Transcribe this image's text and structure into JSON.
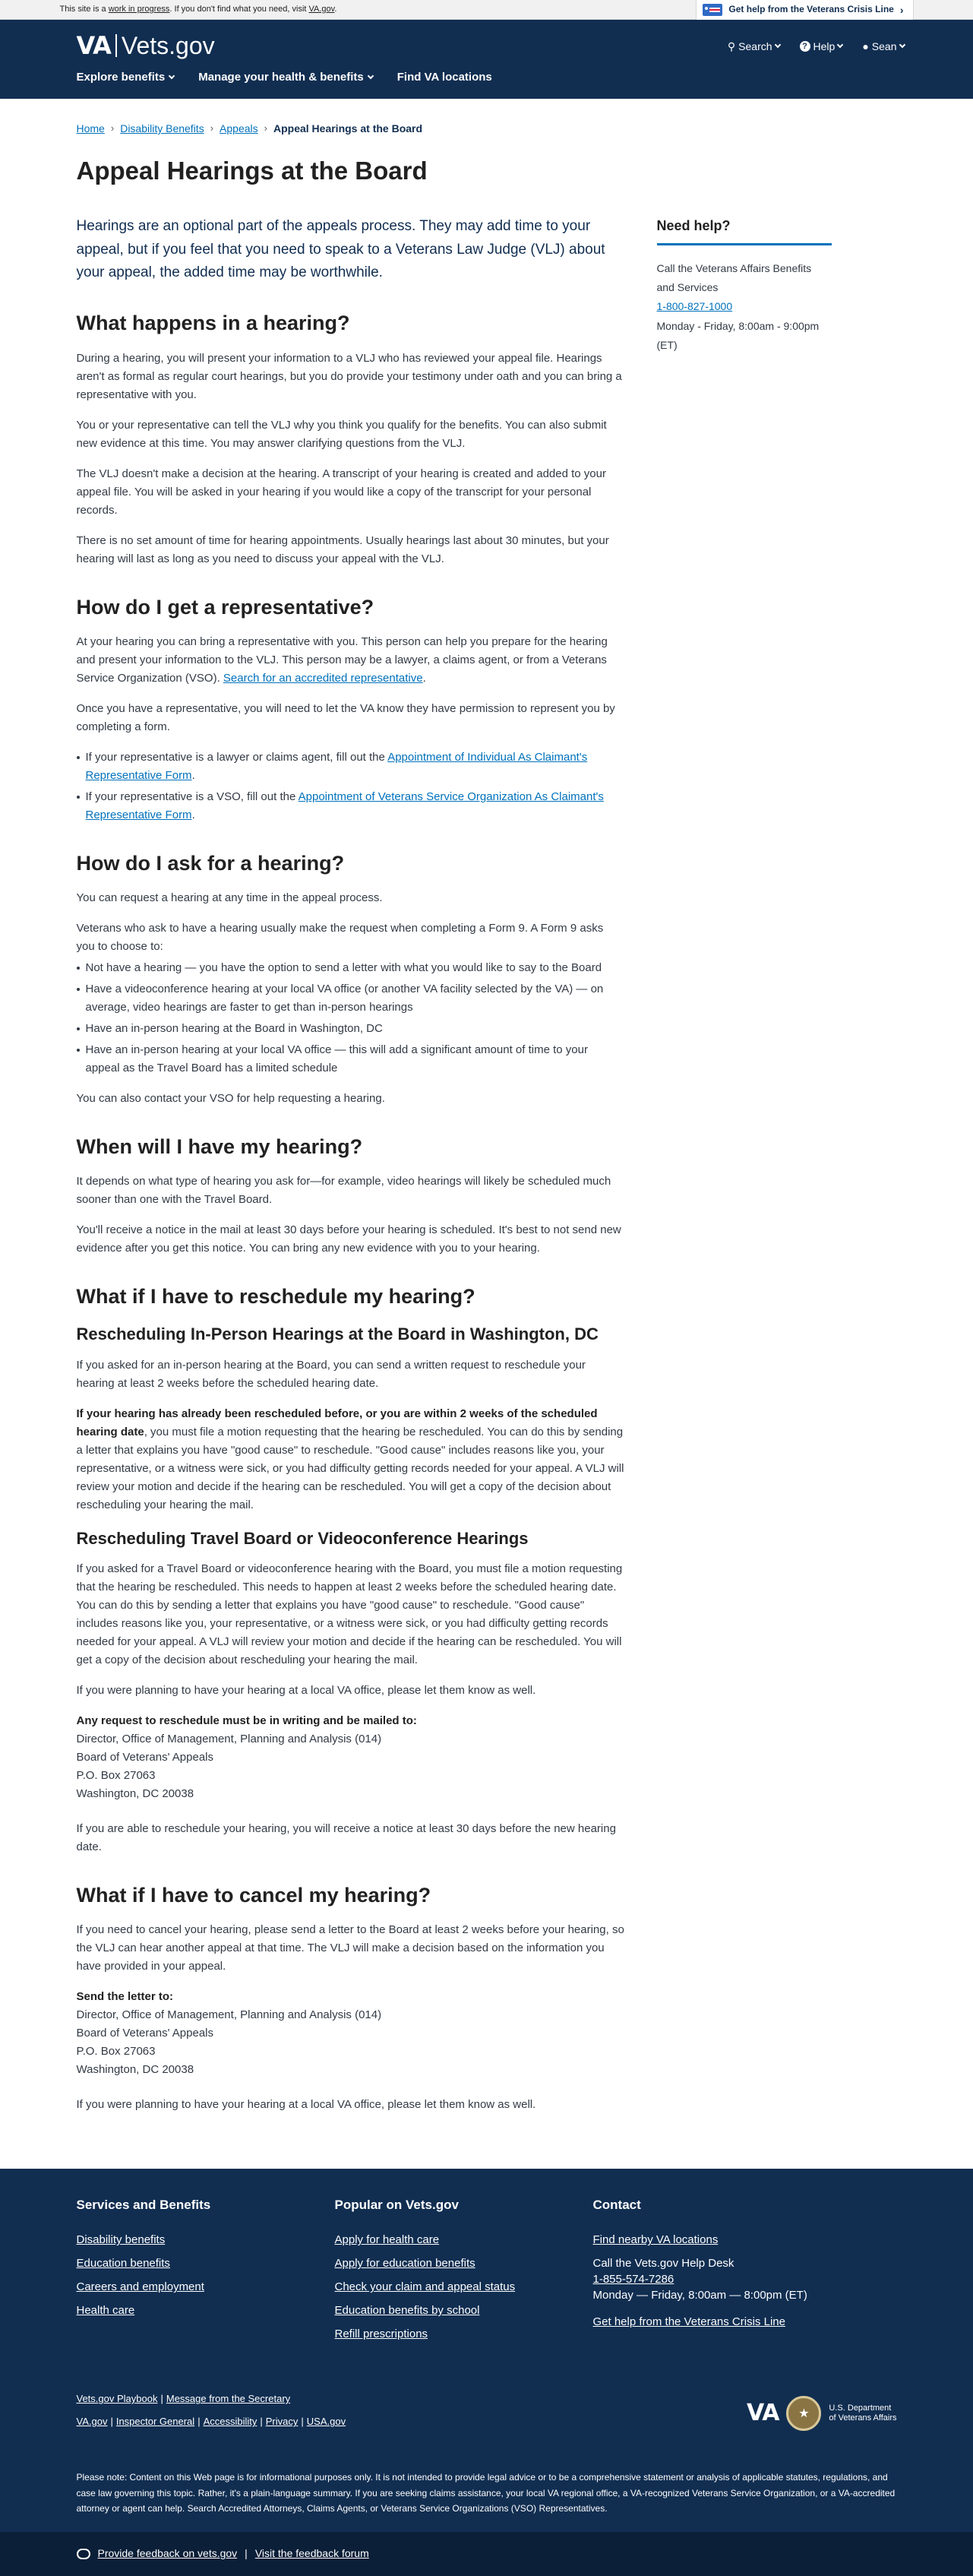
{
  "banner": {
    "msg_prefix": "This site is a",
    "msg_link": "work in progress",
    "msg_middle": ". If you don't find what you need, visit",
    "msg_link2": "VA.gov",
    "msg_suffix": ".",
    "crisis_line": "Get help from the Veterans Crisis Line"
  },
  "header": {
    "logo_va": "VA",
    "logo_site": "Vets.gov",
    "search": "Search",
    "help": "Help",
    "user": "Sean",
    "nav": [
      "Explore benefits",
      "Manage your health & benefits",
      "Find VA locations"
    ]
  },
  "breadcrumb": [
    "Home",
    "Disability Benefits",
    "Appeals",
    "Appeal Hearings at the Board"
  ],
  "page_title": "Appeal Hearings at the Board",
  "lead": "Hearings are an optional part of the appeals process. They may add time to your appeal, but if you feel that you need to speak to a Veterans Law Judge (VLJ) about your appeal, the added time may be worthwhile.",
  "s1": {
    "heading": "What happens in a hearing?",
    "p1": "During a hearing, you will present your information to a VLJ who has reviewed your appeal file. Hearings aren't as formal as regular court hearings, but you do provide your testimony under oath and you can bring a representative with you.",
    "p2": "You or your representative can tell the VLJ why you think you qualify for the benefits. You can also submit new evidence at this time. You may answer clarifying questions from the VLJ.",
    "p3": "The VLJ doesn't make a decision at the hearing. A transcript of your hearing is created and added to your appeal file. You will be asked in your hearing if you would like a copy of the transcript for your personal records.",
    "p4": "There is no set amount of time for hearing appointments. Usually hearings last about 30 minutes, but your hearing will last as long as you need to discuss your appeal with the VLJ."
  },
  "s2": {
    "heading": "How do I get a representative?",
    "p1": "At your hearing you can bring a representative with you. This person can help you prepare for the hearing and present your information to the VLJ. This person may be a lawyer, a claims agent, or from a Veterans Service Organization (VSO).",
    "p1_link": "Search for an accredited representative",
    "p2": "Once you have a representative, you will need to let the VA know they have permission to represent you by completing a form.",
    "b1_text": "If your representative is a lawyer or claims agent, fill out the",
    "b1_link": "Appointment of Individual As Claimant's Representative Form",
    "b2_text": "If your representative is a VSO, fill out the",
    "b2_link": "Appointment of Veterans Service Organization As Claimant's Representative Form"
  },
  "s3": {
    "heading": "How do I ask for a hearing?",
    "p1": "You can request a hearing at any time in the appeal process.",
    "p2": "Veterans who ask to have a hearing usually make the request when completing a Form 9. A Form 9 asks you to choose to:",
    "bullets": [
      "Not have a hearing — you have the option to send a letter with what you would like to say to the Board",
      "Have a videoconference hearing at your local VA office (or another VA facility selected by the VA) — on average, video hearings are faster to get than in-person hearings",
      "Have an in-person hearing at the Board in Washington, DC",
      "Have an in-person hearing at your local VA office — this will add a significant amount of time to your appeal as the Travel Board has a limited schedule"
    ],
    "p3": "You can also contact your VSO for help requesting a hearing."
  },
  "s4": {
    "heading": "When will I have my hearing?",
    "p1": "It depends on what type of hearing you ask for—for example, video hearings will likely be scheduled much sooner than one with the Travel Board.",
    "p2": "You'll receive a notice in the mail at least 30 days before your hearing is scheduled. It's best to not send new evidence after you get this notice. You can bring any new evidence with you to your hearing."
  },
  "s5": {
    "heading": "What if I have to reschedule my hearing?",
    "sub1": "Rescheduling In-Person Hearings at the Board in Washington, DC",
    "sub1_p1": "If you asked for an in-person hearing at the Board, you can send a written request to reschedule your hearing at least 2 weeks before the scheduled hearing date.",
    "sub1_p2_bold": "If your hearing has already been rescheduled before, or you are within 2 weeks of the scheduled hearing date",
    "sub1_p2_rest": ", you must file a motion requesting that the hearing be rescheduled. You can do this by sending a letter that explains you have \"good cause\" to reschedule. \"Good cause\" includes reasons like you, your representative, or a witness were sick, or you had difficulty getting records needed for your appeal. A VLJ will review your motion and decide if the hearing can be rescheduled. You will get a copy of the decision about rescheduling your hearing the mail.",
    "sub2": "Rescheduling Travel Board or Videoconference Hearings",
    "sub2_p1": "If you asked for a Travel Board or videoconference hearing with the Board, you must file a motion requesting that the hearing be rescheduled. This needs to happen at least 2 weeks before the scheduled hearing date. You can do this by sending a letter that explains you have \"good cause\" to reschedule. \"Good cause\" includes reasons like you, your representative, or a witness were sick, or you had difficulty getting records needed for your appeal. A VLJ will review your motion and decide if the hearing can be rescheduled. You will get a copy of the decision about rescheduling your hearing the mail.",
    "sub2_p2": "If you were planning to have your hearing at a local VA office, please let them know as well.",
    "addr_label": "Any request to reschedule must be in writing and be mailed to:",
    "addr_lines": [
      "Director, Office of Management, Planning and Analysis (014)",
      "Board of Veterans' Appeals",
      "P.O. Box 27063",
      "Washington, DC 20038"
    ],
    "p_after": "If you are able to reschedule your hearing, you will receive a notice at least 30 days before the new hearing date."
  },
  "s6": {
    "heading": "What if I have to cancel my hearing?",
    "p1": "If you need to cancel your hearing, please send a letter to the Board at least 2 weeks before your hearing, so the VLJ can hear another appeal at that time. The VLJ will make a decision based on the information you have provided in your appeal.",
    "addr_label": "Send the letter to:",
    "addr_lines": [
      "Director, Office of Management, Planning and Analysis (014)",
      "Board of Veterans' Appeals",
      "P.O. Box 27063",
      "Washington, DC 20038"
    ],
    "p2": "If you were planning to have your hearing at a local VA office, please let them know as well."
  },
  "sidebar": {
    "heading": "Need help?",
    "text": "Call the Veterans Affairs Benefits and Services",
    "phone": "1-800-827-1000",
    "hours": "Monday - Friday, 8:00am - 9:00pm (ET)"
  },
  "footer": {
    "col1_title": "Services and Benefits",
    "col1_links": [
      "Disability benefits",
      "Education benefits",
      "Careers and employment",
      "Health care"
    ],
    "col2_title": "Popular on Vets.gov",
    "col2_links": [
      "Apply for health care",
      "Apply for education benefits",
      "Check your claim and appeal status",
      "Education benefits by school",
      "Refill prescriptions"
    ],
    "col3_title": "Contact",
    "col3_link1": "Find nearby VA locations",
    "col3_call": "Call the Vets.gov Help Desk",
    "col3_phone": "1-855-574-7286",
    "col3_hours": "Monday — Friday, 8:00am — 8:00pm (ET)",
    "col3_crisis": "Get help from the Veterans Crisis Line",
    "bottom_links_row1": [
      "Vets.gov Playbook",
      "Message from the Secretary"
    ],
    "bottom_links_row2": [
      "VA.gov",
      "Inspector General",
      "Accessibility",
      "Privacy",
      "USA.gov"
    ],
    "va_mark": "VA",
    "va_dept_line1": "U.S. Department",
    "va_dept_line2": "of Veterans Affairs",
    "disclaimer": "Please note: Content on this Web page is for informational purposes only. It is not intended to provide legal advice or to be a comprehensive statement or analysis of applicable statutes, regulations, and case law governing this topic. Rather, it's a plain-language summary. If you are seeking claims assistance, your local VA regional office, a VA-recognized Veterans Service Organization, or a VA-accredited attorney or agent can help. Search Accredited Attorneys, Claims Agents, or Veterans Service Organizations (VSO) Representatives.",
    "feedback_link": "Provide feedback on vets.gov",
    "forum_link": "Visit the feedback forum"
  }
}
